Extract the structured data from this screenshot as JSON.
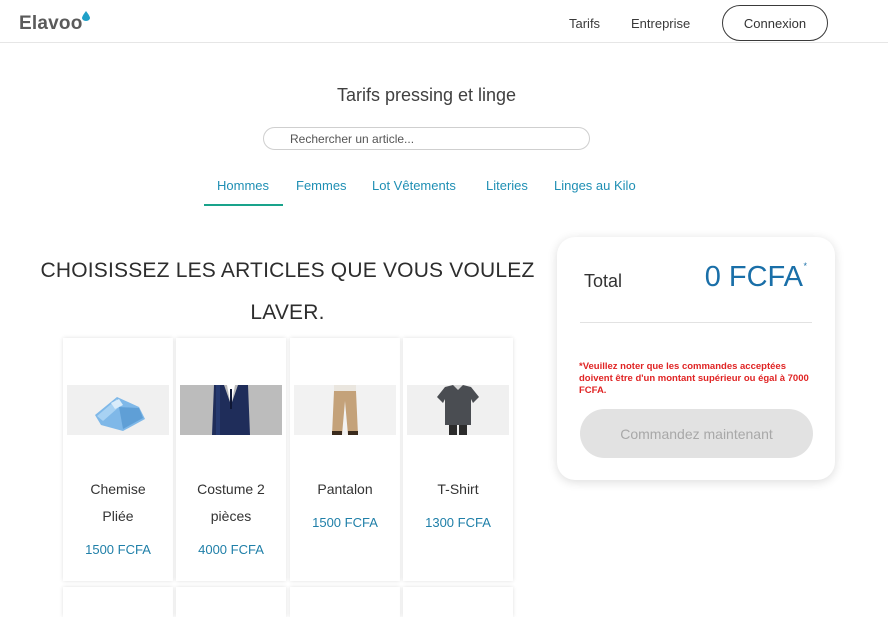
{
  "header": {
    "logo_text": "Elavoo",
    "nav": {
      "tarifs": "Tarifs",
      "entreprise": "Entreprise"
    },
    "login_label": "Connexion"
  },
  "page": {
    "title": "Tarifs pressing et linge"
  },
  "search": {
    "placeholder": "Rechercher un article..."
  },
  "tabs": [
    {
      "label": "Hommes",
      "active": true
    },
    {
      "label": "Femmes"
    },
    {
      "label": "Lot Vêtements"
    },
    {
      "label": "Literies"
    },
    {
      "label": "Linges au Kilo"
    }
  ],
  "heading": {
    "line1": "CHOISISSEZ LES ARTICLES QUE VOUS VOULEZ",
    "line2": "LAVER."
  },
  "products": [
    {
      "name_line1": "Chemise",
      "name_line2": "Pliée",
      "price": "1500 FCFA",
      "icon": "shirt-folded-icon"
    },
    {
      "name_line1": "Costume 2",
      "name_line2": "pièces",
      "price": "4000 FCFA",
      "icon": "suit-icon"
    },
    {
      "name_line1": "Pantalon",
      "name_line2": "",
      "price": "1500 FCFA",
      "icon": "pants-icon"
    },
    {
      "name_line1": "T-Shirt",
      "name_line2": "",
      "price": "1300 FCFA",
      "icon": "tshirt-icon"
    }
  ],
  "cart": {
    "total_label": "Total",
    "total_value": "0 FCFA",
    "asterisk": "*",
    "note": "*Veuillez noter que les commandes acceptées doivent être d'un montant supérieur ou égal à 7000 FCFA.",
    "order_label": "Commandez maintenant"
  },
  "colors": {
    "accent": "#1f8fb4",
    "tab_underline": "#19a38b",
    "price": "#1f7fa8",
    "warning": "#e02424"
  }
}
